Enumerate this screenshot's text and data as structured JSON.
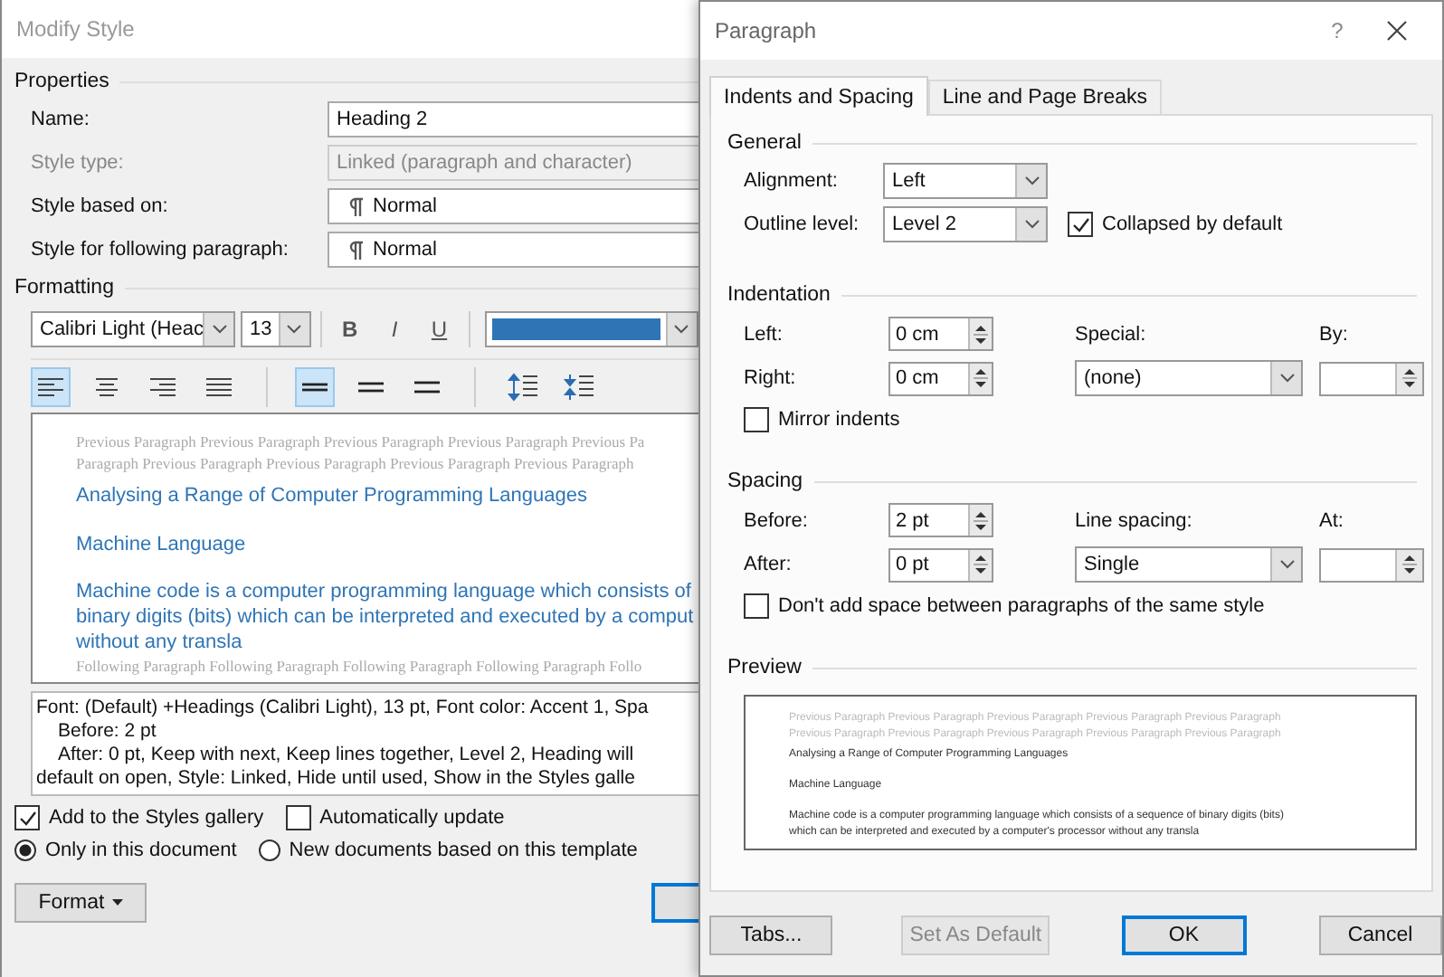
{
  "modify_style": {
    "title": "Modify Style",
    "properties": {
      "heading": "Properties",
      "fields": [
        {
          "label": "Name:",
          "value": "Heading 2",
          "kind": "text",
          "disabled": false
        },
        {
          "label": "Style type:",
          "value": "Linked (paragraph and character)",
          "kind": "text",
          "disabled": true
        },
        {
          "label": "Style based on:",
          "value": "Normal",
          "kind": "style",
          "disabled": false
        },
        {
          "label": "Style for following paragraph:",
          "value": "Normal",
          "kind": "style",
          "disabled": false
        }
      ]
    },
    "formatting": {
      "heading": "Formatting",
      "font": "Calibri Light (Heac",
      "size": "13",
      "styles": [
        {
          "kind": "bold",
          "label": "B",
          "selected": false
        },
        {
          "kind": "italic",
          "label": "I",
          "selected": false
        },
        {
          "kind": "underline",
          "label": "U",
          "selected": false
        }
      ],
      "align_buttons": [
        {
          "kind": "left",
          "selected": true
        },
        {
          "kind": "center",
          "selected": false
        },
        {
          "kind": "right",
          "selected": false
        },
        {
          "kind": "justify",
          "selected": false
        }
      ],
      "spacing_buttons": [
        {
          "kind": "single",
          "selected": true
        },
        {
          "kind": "onehalf",
          "selected": false
        },
        {
          "kind": "double",
          "selected": false
        }
      ],
      "para_buttons": [
        {
          "kind": "increase"
        },
        {
          "kind": "decrease"
        }
      ]
    },
    "preview": {
      "previous_lines": [
        "Previous Paragraph Previous Paragraph Previous Paragraph Previous Paragraph Previous Pa",
        "Paragraph Previous Paragraph Previous Paragraph Previous Paragraph Previous Paragraph"
      ],
      "headings": [
        "Analysing a Range of Computer Programming Languages",
        "Machine Language"
      ],
      "body_lines": [
        "Machine code is a computer programming language which consists of",
        "binary digits (bits) which can be interpreted and executed by a comput",
        "without any transla"
      ],
      "following_lines": [
        "Following Paragraph Following Paragraph Following Paragraph Following Paragraph Follo"
      ]
    },
    "description": [
      "Font: (Default) +Headings (Calibri Light), 13 pt, Font color: Accent 1, Spa",
      "Before:  2 pt",
      "After:  0 pt, Keep with next, Keep lines together, Level 2, Heading will",
      "default on open, Style: Linked, Hide until used, Show in the Styles galle"
    ],
    "checkboxes": [
      {
        "label": "Add to the Styles gallery",
        "checked": true
      },
      {
        "label": "Automatically update",
        "checked": false
      }
    ],
    "radios": [
      {
        "label": "Only in this document",
        "selected": true
      },
      {
        "label": "New documents based on this template",
        "selected": false
      }
    ],
    "format_button": "Format"
  },
  "paragraph": {
    "title": "Paragraph",
    "help": "?",
    "tabs": [
      {
        "label": "Indents and Spacing",
        "selected": true
      },
      {
        "label": "Line and Page Breaks",
        "selected": false
      }
    ],
    "general": {
      "heading": "General",
      "alignment_label": "Alignment:",
      "alignment": "Left",
      "outline_label": "Outline level:",
      "outline": "Level 2",
      "collapsed": {
        "label": "Collapsed by default",
        "checked": true
      }
    },
    "indentation": {
      "heading": "Indentation",
      "left_label": "Left:",
      "left": "0 cm",
      "right_label": "Right:",
      "right": "0 cm",
      "special_label": "Special:",
      "special": "(none)",
      "by_label": "By:",
      "mirror": {
        "label": "Mirror indents",
        "checked": false
      }
    },
    "spacing": {
      "heading": "Spacing",
      "before_label": "Before:",
      "before": "2 pt",
      "after_label": "After:",
      "after": "0 pt",
      "line_label": "Line spacing:",
      "line": "Single",
      "at_label": "At:",
      "dont_add": {
        "label": "Don't add space between paragraphs of the same style",
        "checked": false
      }
    },
    "preview": {
      "heading": "Preview",
      "previous_lines": [
        "Previous Paragraph Previous Paragraph Previous Paragraph Previous Paragraph Previous Paragraph",
        "Previous Paragraph Previous Paragraph Previous Paragraph Previous Paragraph Previous Paragraph"
      ],
      "lines": [
        "Analysing a Range of Computer Programming Languages",
        "Machine Language",
        "Machine code is a computer programming language which consists of a sequence of binary digits (bits)",
        "which can be interpreted and executed by a computer's processor without any transla"
      ]
    },
    "buttons": [
      {
        "label": "Tabs...",
        "kind": "normal",
        "disabled": false
      },
      {
        "label": "Set As Default",
        "kind": "normal",
        "disabled": true
      },
      {
        "label": "OK",
        "kind": "default",
        "disabled": false
      },
      {
        "label": "Cancel",
        "kind": "normal",
        "disabled": false
      }
    ]
  }
}
